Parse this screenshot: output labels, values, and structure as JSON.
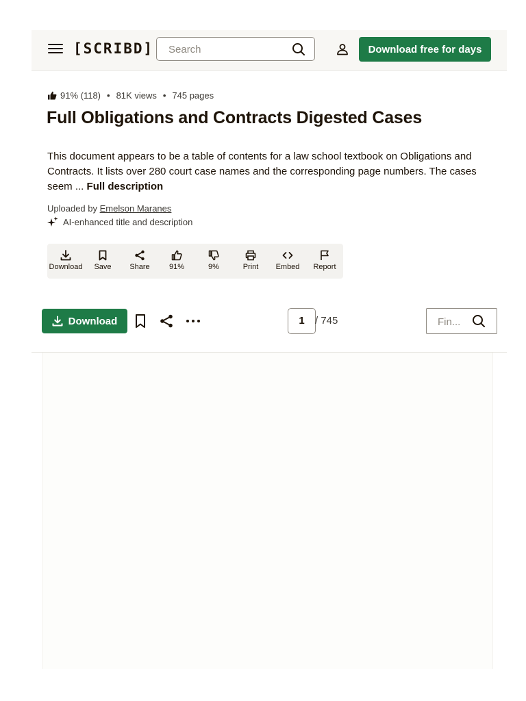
{
  "header": {
    "logo": "[SCRIBD]",
    "search_placeholder": "Search",
    "cta_label": "Download free for days"
  },
  "document": {
    "rating": "91% (118)",
    "views": "81K views",
    "pages": "745 pages",
    "title": "Full Obligations and Contracts Digested Cases",
    "description": "This document appears to be a table of contents for a law school textbook on Obligations and Contracts. It lists over 280 court case names and the corresponding page numbers. The cases seem ...",
    "full_description_label": "Full description",
    "uploaded_by_label": "Uploaded by",
    "uploader": "Emelson Maranes",
    "ai_note": "AI-enhanced title and description"
  },
  "actions": {
    "download": "Download",
    "save": "Save",
    "share": "Share",
    "upvote": "91%",
    "downvote": "9%",
    "print": "Print",
    "embed": "Embed",
    "report": "Report"
  },
  "viewer": {
    "download_label": "Download",
    "current_page": "1",
    "total_pages": "/ 745",
    "find_placeholder": "Fin..."
  },
  "colors": {
    "brand_green": "#1e7b47",
    "text": "#1e1409",
    "header_bg": "#f8f7f4"
  }
}
